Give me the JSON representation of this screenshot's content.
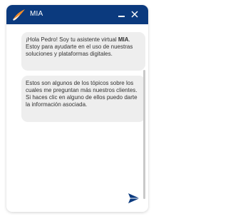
{
  "header": {
    "title": "MIA",
    "minimize_icon": "minimize-icon",
    "close_icon": "close-icon",
    "logo_icon": "mia-logo-icon"
  },
  "messages": [
    {
      "parts": [
        "¡Hola Pedro! Soy tu asistente virtual ",
        "MIA",
        ". Estoy para ayudarte en el uso de nuestras soluciones y plataformas digitales."
      ]
    },
    {
      "text": "Estos son algunos de los tópicos sobre los cuales me preguntan más nuestros clientes. Si haces clic en alguno de ellos puedo darte la información asociada."
    }
  ],
  "composer": {
    "input_value": "",
    "send_icon": "send-icon"
  },
  "colors": {
    "header_bg": "#0b3a7e",
    "accent": "#0b3a7e",
    "bubble_bg": "#eeeeee",
    "logo_orange": "#f28c28"
  }
}
